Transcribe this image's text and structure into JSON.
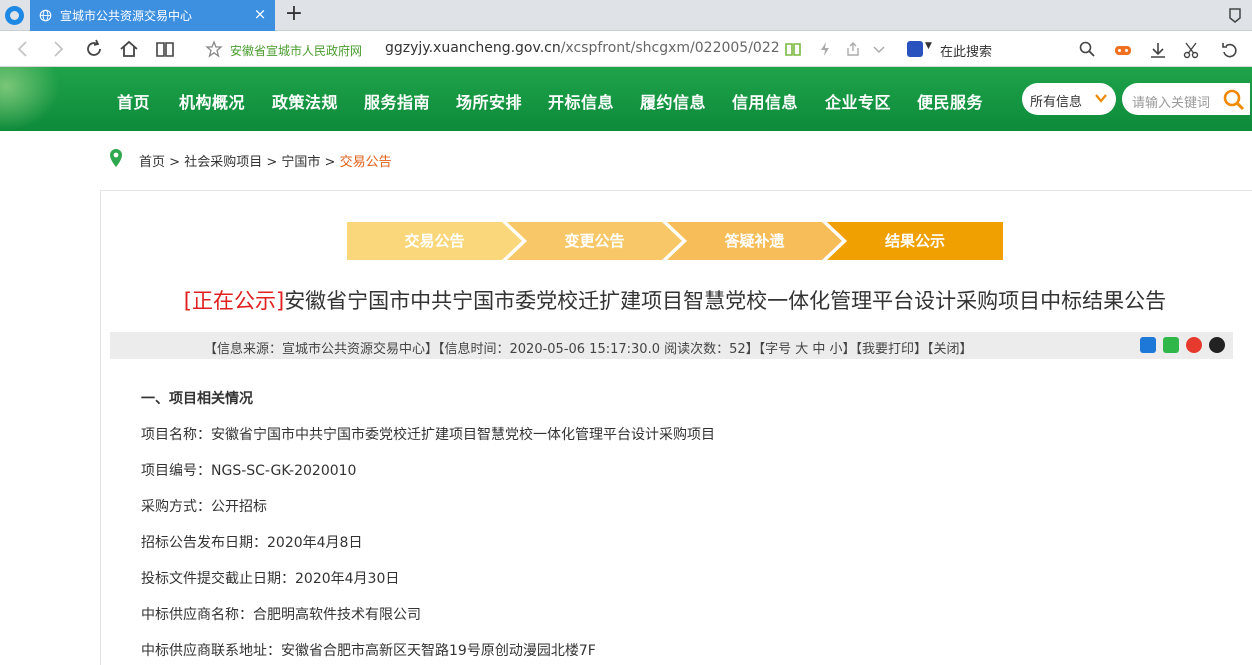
{
  "browser": {
    "tab_title": "宣城市公共资源交易中心",
    "site_name": "安徽省宣城市人民政府网",
    "url_host": "ggzyjy.xuancheng.gov.cn",
    "url_path": "/xcspfront/shcgxm/022005/022",
    "search_placeholder": "在此搜索"
  },
  "header": {
    "nav": [
      "首页",
      "机构概况",
      "政策法规",
      "服务指南",
      "场所安排",
      "开标信息",
      "履约信息",
      "信用信息",
      "企业专区",
      "便民服务"
    ],
    "scope_select": "所有信息",
    "keyword_placeholder": "请输入关键词"
  },
  "breadcrumb": {
    "items": [
      "首页",
      "社会采购项目",
      "宁国市"
    ],
    "separator": " > ",
    "current": "交易公告"
  },
  "steps": [
    "交易公告",
    "变更公告",
    "答疑补遗",
    "结果公示"
  ],
  "article": {
    "status": "[正在公示]",
    "title": "安徽省宁国市中共宁国市委党校迁扩建项目智慧党校一体化管理平台设计采购项目中标结果公告",
    "meta": "【信息来源：宣城市公共资源交易中心】【信息时间：2020-05-06 15:17:30.0 阅读次数：52】【字号 大 中 小】【我要打印】【关闭】",
    "section_title": "一、项目相关情况",
    "fields": [
      "项目名称：安徽省宁国市中共宁国市委党校迁扩建项目智慧党校一体化管理平台设计采购项目",
      "项目编号：NGS-SC-GK-2020010",
      "采购方式：公开招标",
      "招标公告发布日期：2020年4月8日",
      "投标文件提交截止日期：2020年4月30日",
      "中标供应商名称：合肥明高软件技术有限公司",
      "中标供应商联系地址：安徽省合肥市高新区天智路19号原创动漫园北楼7F"
    ]
  },
  "colors": {
    "header_green": "#0d8a3a",
    "accent_orange": "#f0a000",
    "status_red": "#e02020",
    "tab_blue": "#3d8fe0"
  }
}
